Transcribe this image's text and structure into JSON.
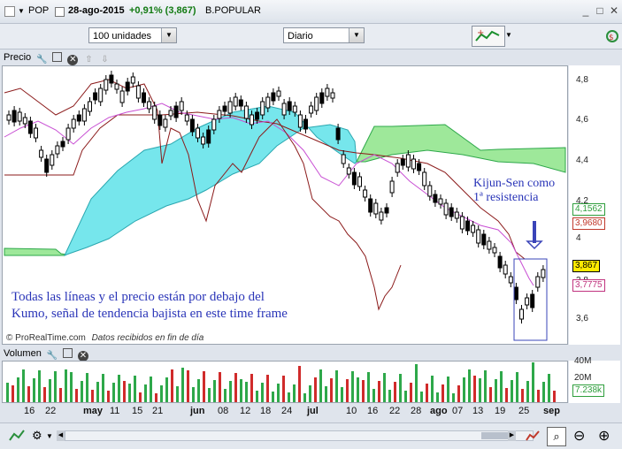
{
  "header": {
    "ticker": "POP",
    "date": "28-ago-2015",
    "change": "+0,91% (3,867)",
    "name": "B.POPULAR"
  },
  "toolbar": {
    "units": "100 unidades",
    "period": "Diario"
  },
  "price_panel": {
    "title": "Precio",
    "y_ticks": [
      "4,8",
      "4,6",
      "4,4",
      "4,2",
      "4",
      "3,8",
      "3,6"
    ],
    "tags": [
      {
        "text": "4,1562",
        "color": "#2e9e3c"
      },
      {
        "text": "3,9680",
        "color": "#c0392b"
      },
      {
        "text": "3,867",
        "color": "#000000"
      },
      {
        "text": "3,7775",
        "color": "#c0337e"
      }
    ],
    "source": "© ProRealTime.com",
    "source_note": "Datos recibidos en fin de día"
  },
  "annotations": {
    "kijun_line1": "Kijun-Sen como",
    "kijun_line2": "1ª resistencia",
    "text_line1": "Todas las líneas y el precio están por debajo del",
    "text_line2": "Kumo, señal de tendencia bajista en este time frame"
  },
  "volume_panel": {
    "title": "Volumen",
    "y_ticks": [
      "40M",
      "20M"
    ],
    "tag": "7.238k"
  },
  "x_labels": [
    "16",
    "22",
    "may",
    "11",
    "15",
    "21",
    "jun",
    "08",
    "12",
    "18",
    "24",
    "jul",
    "10",
    "16",
    "22",
    "28",
    "ago",
    "07",
    "13",
    "19",
    "25",
    "sep"
  ],
  "colors": {
    "up": "#ffffff",
    "down": "#000000",
    "kumo_bull": "#9ee89a",
    "kumo_bear": "#76e6ec",
    "kijun": "#8b1a1a",
    "tenkan": "#c84fd3",
    "chikou": "#8b1a1a",
    "vol_up": "#2ea84a",
    "vol_down": "#d02b2b"
  }
}
